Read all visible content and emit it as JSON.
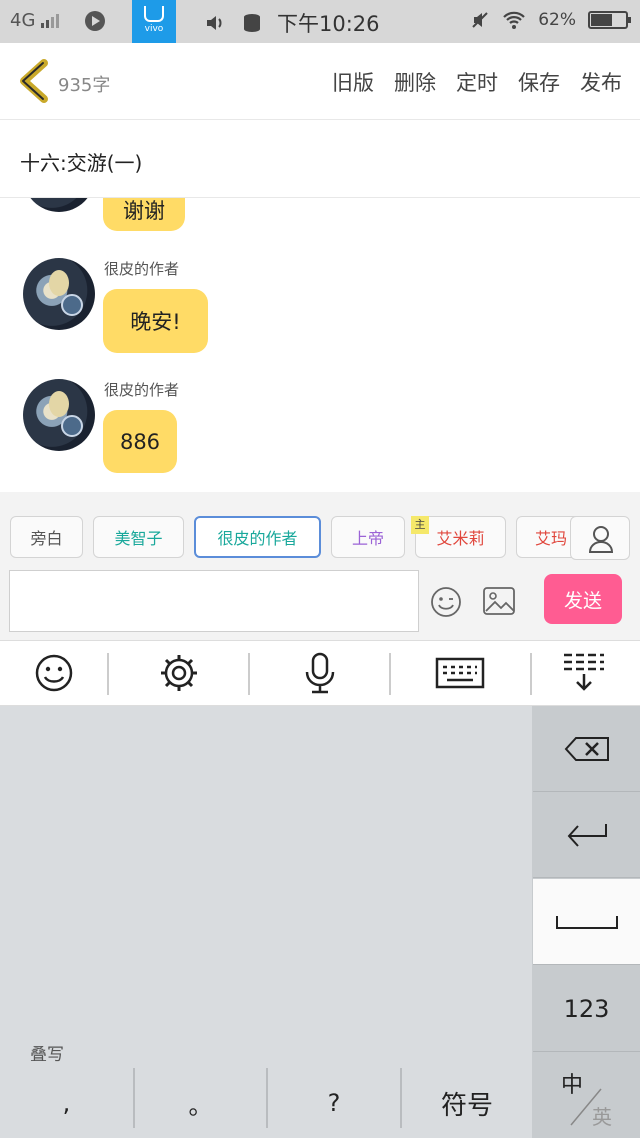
{
  "status_bar": {
    "network": "4G",
    "store_label": "vivo",
    "time": "下午10:26",
    "battery_text": "62%",
    "battery_level": 0.62
  },
  "toolbar": {
    "word_count": "935字",
    "actions": [
      "旧版",
      "删除",
      "定时",
      "保存",
      "发布"
    ]
  },
  "chapter": {
    "title": "十六:交游(一)"
  },
  "messages": [
    {
      "speaker": "",
      "text": "谢谢"
    },
    {
      "speaker": "很皮的作者",
      "text": "晚安!"
    },
    {
      "speaker": "很皮的作者",
      "text": "886"
    }
  ],
  "roles": [
    {
      "label": "旁白",
      "color": "#555555"
    },
    {
      "label": "美智子",
      "color": "#19a89b"
    },
    {
      "label": "很皮的作者",
      "color": "#19a89b"
    },
    {
      "label": "上帝",
      "color": "#9b63d6"
    },
    {
      "label": "艾米莉",
      "color": "#e0463c"
    },
    {
      "label": "艾玛",
      "color": "#e0463c"
    }
  ],
  "main_badge": "主",
  "composer": {
    "input_value": "",
    "send_label": "发送"
  },
  "keyboard": {
    "overlap_label": "叠写",
    "punctuation": [
      ",",
      "。",
      "?",
      "符号"
    ],
    "side_keys": {
      "numbers": "123",
      "lang_primary": "中",
      "lang_secondary": "英"
    }
  },
  "icons": [
    "back-chevron-icon",
    "emoji-icon",
    "image-icon",
    "person-icon",
    "gear-icon",
    "microphone-icon",
    "keyboard-icon",
    "collapse-keyboard-icon",
    "backspace-icon",
    "enter-icon",
    "space-icon"
  ],
  "colors": {
    "accent_pink": "#ff5c92",
    "bubble_yellow": "#ffdb66",
    "active_chip_border": "#5b8dd9",
    "back_arrow": "#c9a92a"
  }
}
